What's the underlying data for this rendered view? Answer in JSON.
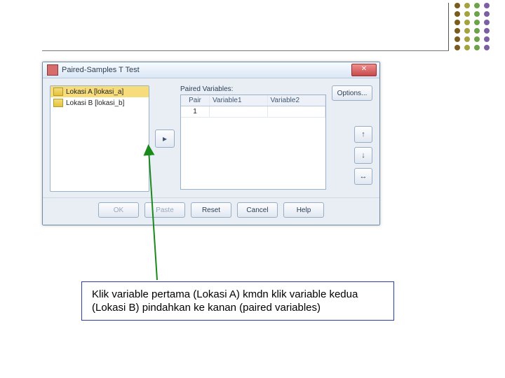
{
  "dialog": {
    "title": "Paired-Samples T Test",
    "close_glyph": "✕",
    "vars": [
      {
        "label": "Lokasi A [lokasi_a]",
        "selected": true
      },
      {
        "label": "Lokasi B [lokasi_b]",
        "selected": false
      }
    ],
    "move_arrow_glyph": "▸",
    "pairs_label": "Paired Variables:",
    "pairs_headers": {
      "pair": "Pair",
      "v1": "Variable1",
      "v2": "Variable2"
    },
    "pairs_rows": [
      {
        "pair": "1",
        "v1": "",
        "v2": ""
      }
    ],
    "options_btn": "Options...",
    "reorder": {
      "up": "↑",
      "down": "↓",
      "swap": "↔"
    },
    "footer": {
      "ok": "OK",
      "paste": "Paste",
      "reset": "Reset",
      "cancel": "Cancel",
      "help": "Help"
    }
  },
  "callout": {
    "text": "Klik variable pertama (Lokasi A) kmdn klik variable kedua (Lokasi B) pindahkan ke kanan (paired variables)"
  }
}
